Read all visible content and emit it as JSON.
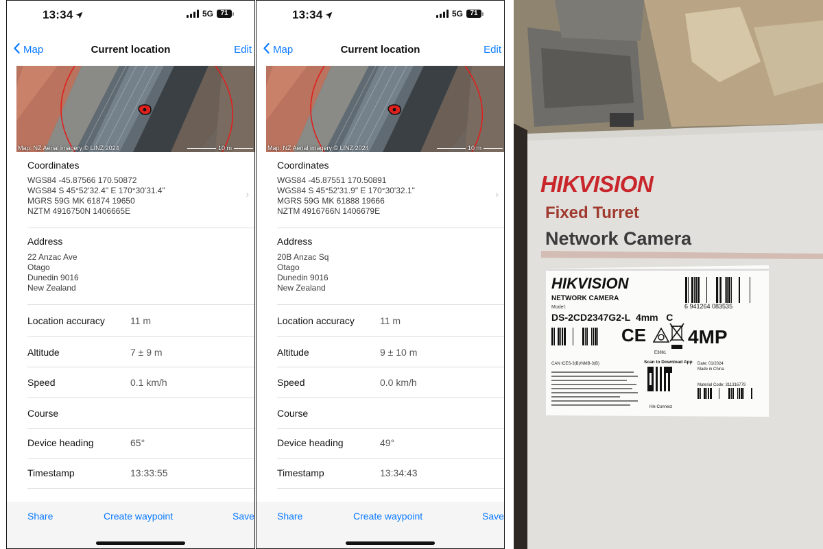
{
  "phones": [
    {
      "status_time": "13:34",
      "network": "5G",
      "battery": "71",
      "nav": {
        "back_label": "Map",
        "title": "Current location",
        "edit_label": "Edit"
      },
      "map": {
        "credit": "Map: NZ Aerial imagery © LINZ 2024",
        "scale": "10 m"
      },
      "coordinates": {
        "title": "Coordinates",
        "lines": [
          "WGS84 -45.87566 170.50872",
          "WGS84 S 45°52'32.4\" E 170°30'31.4\"",
          "MGRS 59G MK 61874 19650",
          "NZTM 4916750N 1406665E"
        ]
      },
      "address": {
        "title": "Address",
        "lines": [
          "22 Anzac Ave",
          "Otago",
          "Dunedin 9016",
          "New Zealand"
        ]
      },
      "rows": [
        {
          "label": "Location accuracy",
          "value": "11 m"
        },
        {
          "label": "Altitude",
          "value": "7 ± 9 m"
        },
        {
          "label": "Speed",
          "value": "0.1 km/h"
        },
        {
          "label": "Course",
          "value": ""
        },
        {
          "label": "Device heading",
          "value": "65°"
        },
        {
          "label": "Timestamp",
          "value": "13:33:55"
        }
      ],
      "toolbar": {
        "share": "Share",
        "waypoint": "Create waypoint",
        "save": "Save"
      }
    },
    {
      "status_time": "13:34",
      "network": "5G",
      "battery": "71",
      "nav": {
        "back_label": "Map",
        "title": "Current location",
        "edit_label": "Edit"
      },
      "map": {
        "credit": "Map: NZ Aerial imagery © LINZ 2024",
        "scale": "10 m"
      },
      "coordinates": {
        "title": "Coordinates",
        "lines": [
          "WGS84 -45.87551 170.50891",
          "WGS84 S 45°52'31.9\" E 170°30'32.1\"",
          "MGRS 59G MK 61888 19666",
          "NZTM 4916766N 1406679E"
        ]
      },
      "address": {
        "title": "Address",
        "lines": [
          "20B Anzac Sq",
          "Otago",
          "Dunedin 9016",
          "New Zealand"
        ]
      },
      "rows": [
        {
          "label": "Location accuracy",
          "value": "11 m"
        },
        {
          "label": "Altitude",
          "value": "9 ± 10 m"
        },
        {
          "label": "Speed",
          "value": "0.0 km/h"
        },
        {
          "label": "Course",
          "value": ""
        },
        {
          "label": "Device heading",
          "value": "49°"
        },
        {
          "label": "Timestamp",
          "value": "13:34:43"
        }
      ],
      "toolbar": {
        "share": "Share",
        "waypoint": "Create waypoint",
        "save": "Save"
      }
    }
  ],
  "photo": {
    "brand": "HIKVISION",
    "product_line1": "Fixed Turret",
    "product_line2": "Network Camera",
    "label": {
      "brand": "HIKVISION",
      "subtitle": "NETWORK CAMERA",
      "model_caption": "Model:",
      "model": "DS-2CD2347G2-L",
      "lens": "4mm",
      "variant": "C",
      "barcode_digits": "6 941264 083535",
      "resolution": "4MP",
      "scan_caption": "Scan to Download App",
      "app_name": "Hik-Connect",
      "date_line": "Date: 01/2024",
      "origin_line": "Made in China",
      "material_code": "Material Code: 311316779",
      "can_ices": "CAN ICES-3(B)/NMB-3(B)",
      "code_e": "E3861"
    }
  },
  "colors": {
    "ios_blue": "#0a7aff",
    "hik_red": "#c8262b",
    "accuracy_circle": "#e0201d"
  }
}
